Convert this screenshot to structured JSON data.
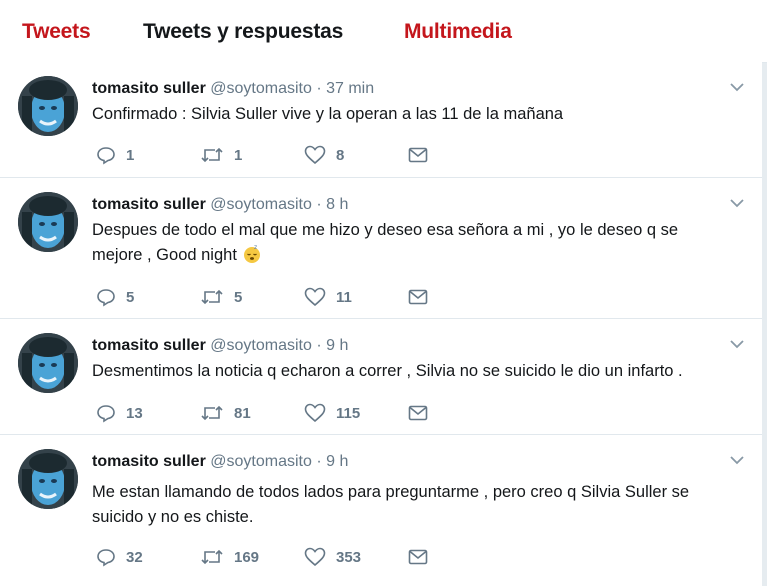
{
  "tabs": [
    {
      "label": "Tweets"
    },
    {
      "label": "Tweets y respuestas"
    },
    {
      "label": "Multimedia"
    }
  ],
  "colors": {
    "accent": "#c4161c",
    "muted": "#657786",
    "text": "#14171a"
  },
  "tweets": [
    {
      "name": "tomasito suller",
      "handle": "@soytomasito",
      "dot": "·",
      "time": "37 min",
      "text": "Confirmado : Silvia Suller vive y la operan a las 11 de la mañana",
      "text2": "",
      "replies": "1",
      "retweets": "1",
      "likes": "8"
    },
    {
      "name": "tomasito suller",
      "handle": "@soytomasito",
      "dot": "·",
      "time": "8 h",
      "text": "Despues de todo el mal que me hizo y deseo esa señora a mi , yo le deseo q se",
      "text2": "mejore , Good night",
      "emoji": "sleepy-face-icon",
      "replies": "5",
      "retweets": "5",
      "likes": "11"
    },
    {
      "name": "tomasito suller",
      "handle": "@soytomasito",
      "dot": "·",
      "time": "9 h",
      "text": "Desmentimos la noticia q echaron a correr , Silvia no se suicido le dio un infarto .",
      "text2": "",
      "replies": "13",
      "retweets": "81",
      "likes": "115"
    },
    {
      "name": "tomasito suller",
      "handle": "@soytomasito",
      "dot": "·",
      "time": "9 h",
      "text": "Me estan llamando de todos lados para preguntarme , pero creo q Silvia Suller se",
      "text2": "suicido y no es chiste.",
      "replies": "32",
      "retweets": "169",
      "likes": "353"
    }
  ]
}
